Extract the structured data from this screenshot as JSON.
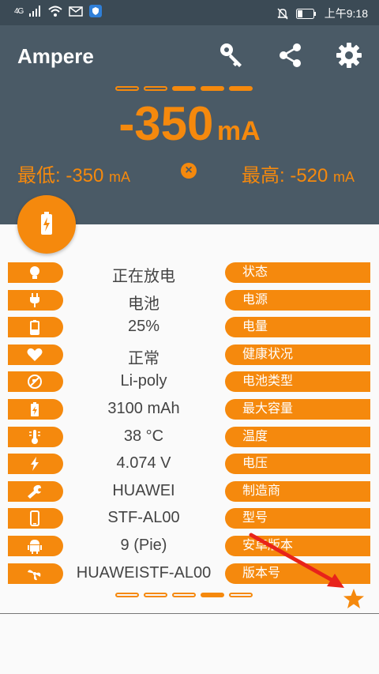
{
  "status_bar": {
    "network": "4G",
    "time": "上午9:18"
  },
  "app": {
    "title": "Ampere"
  },
  "current": {
    "value": "-350",
    "unit": "mA"
  },
  "min": {
    "label": "最低: -350",
    "unit": "mA"
  },
  "max": {
    "label": "最高: -520",
    "unit": "mA"
  },
  "rows": [
    {
      "icon": "lightbulb-icon",
      "value": "正在放电",
      "label": "状态"
    },
    {
      "icon": "plug-icon",
      "value": "电池",
      "label": "电源"
    },
    {
      "icon": "battery-icon",
      "value": "25%",
      "label": "电量"
    },
    {
      "icon": "heart-icon",
      "value": "正常",
      "label": "健康状况"
    },
    {
      "icon": "battery-type-icon",
      "value": "Li-poly",
      "label": "电池类型"
    },
    {
      "icon": "battery-charging-icon",
      "value": "3100 mAh",
      "label": "最大容量"
    },
    {
      "icon": "thermometer-icon",
      "value": "38 °C",
      "label": "温度"
    },
    {
      "icon": "lightning-icon",
      "value": "4.074 V",
      "label": "电压"
    },
    {
      "icon": "wrench-icon",
      "value": "HUAWEI",
      "label": "制造商"
    },
    {
      "icon": "phone-icon",
      "value": "STF-AL00",
      "label": "型号"
    },
    {
      "icon": "android-icon",
      "value": "9 (Pie)",
      "label": "安卓版本"
    },
    {
      "icon": "fan-icon",
      "value": "HUAWEISTF-AL00",
      "label": "版本号"
    }
  ],
  "colors": {
    "accent": "#f5890d",
    "header": "#4a5a66",
    "annotation_arrow": "#e8231a"
  }
}
